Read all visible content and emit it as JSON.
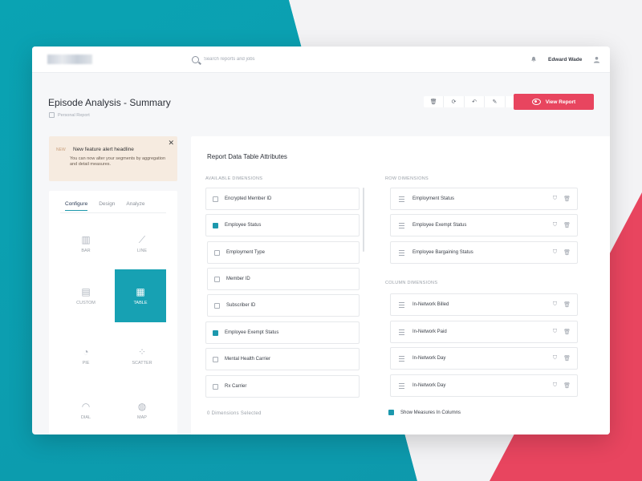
{
  "header": {
    "search_placeholder": "Search reports and jobs",
    "user_name": "Edward Wade"
  },
  "page": {
    "title": "Episode Analysis - Summary",
    "subtitle": "Personal Report",
    "view_report_label": "View Report"
  },
  "alert": {
    "badge": "NEW",
    "title": "New feature alert headline",
    "body": "You can now alter your segments by aggregation and detail measures."
  },
  "left_panel": {
    "tabs": [
      "Configure",
      "Design",
      "Analyze"
    ],
    "chart_types": [
      {
        "label": "BAR",
        "icon": "bar-chart-icon"
      },
      {
        "label": "LINE",
        "icon": "line-chart-icon"
      },
      {
        "label": "CUSTOM",
        "icon": "custom-chart-icon"
      },
      {
        "label": "TABLE",
        "icon": "table-icon"
      },
      {
        "label": "PIE",
        "icon": "pie-chart-icon"
      },
      {
        "label": "SCATTER",
        "icon": "scatter-chart-icon"
      },
      {
        "label": "DIAL",
        "icon": "dial-icon"
      },
      {
        "label": "MAP",
        "icon": "map-icon"
      }
    ]
  },
  "main": {
    "title": "Report Data Table Attributes",
    "available_label": "AVAILABLE DIMENSIONS",
    "row_label": "ROW DIMENSIONS",
    "column_label": "COLUMN DIMENSIONS",
    "available": [
      {
        "label": "Encrypted Member ID",
        "checked": false
      },
      {
        "label": "Employee Status",
        "checked": true
      },
      {
        "label": "Employment Type",
        "checked": false
      },
      {
        "label": "Member ID",
        "checked": false
      },
      {
        "label": "Subscriber ID",
        "checked": false
      },
      {
        "label": "Employee Exempt Status",
        "checked": true
      },
      {
        "label": "Mental Health Carrier",
        "checked": false
      },
      {
        "label": "Rx Carrier",
        "checked": false
      }
    ],
    "rows": [
      "Employment Status",
      "Employee Exempt Status",
      "Employee Bargaining Status"
    ],
    "columns": [
      "In-Network Billed",
      "In-Network Paid",
      "In-Network Day",
      "In-Network Day"
    ],
    "dimensions_selected": "0 Dimensions Selected",
    "show_measures": "Show Measures In Columns"
  },
  "colors": {
    "accent": "#1c98ad",
    "primary_button": "#e8455f"
  }
}
